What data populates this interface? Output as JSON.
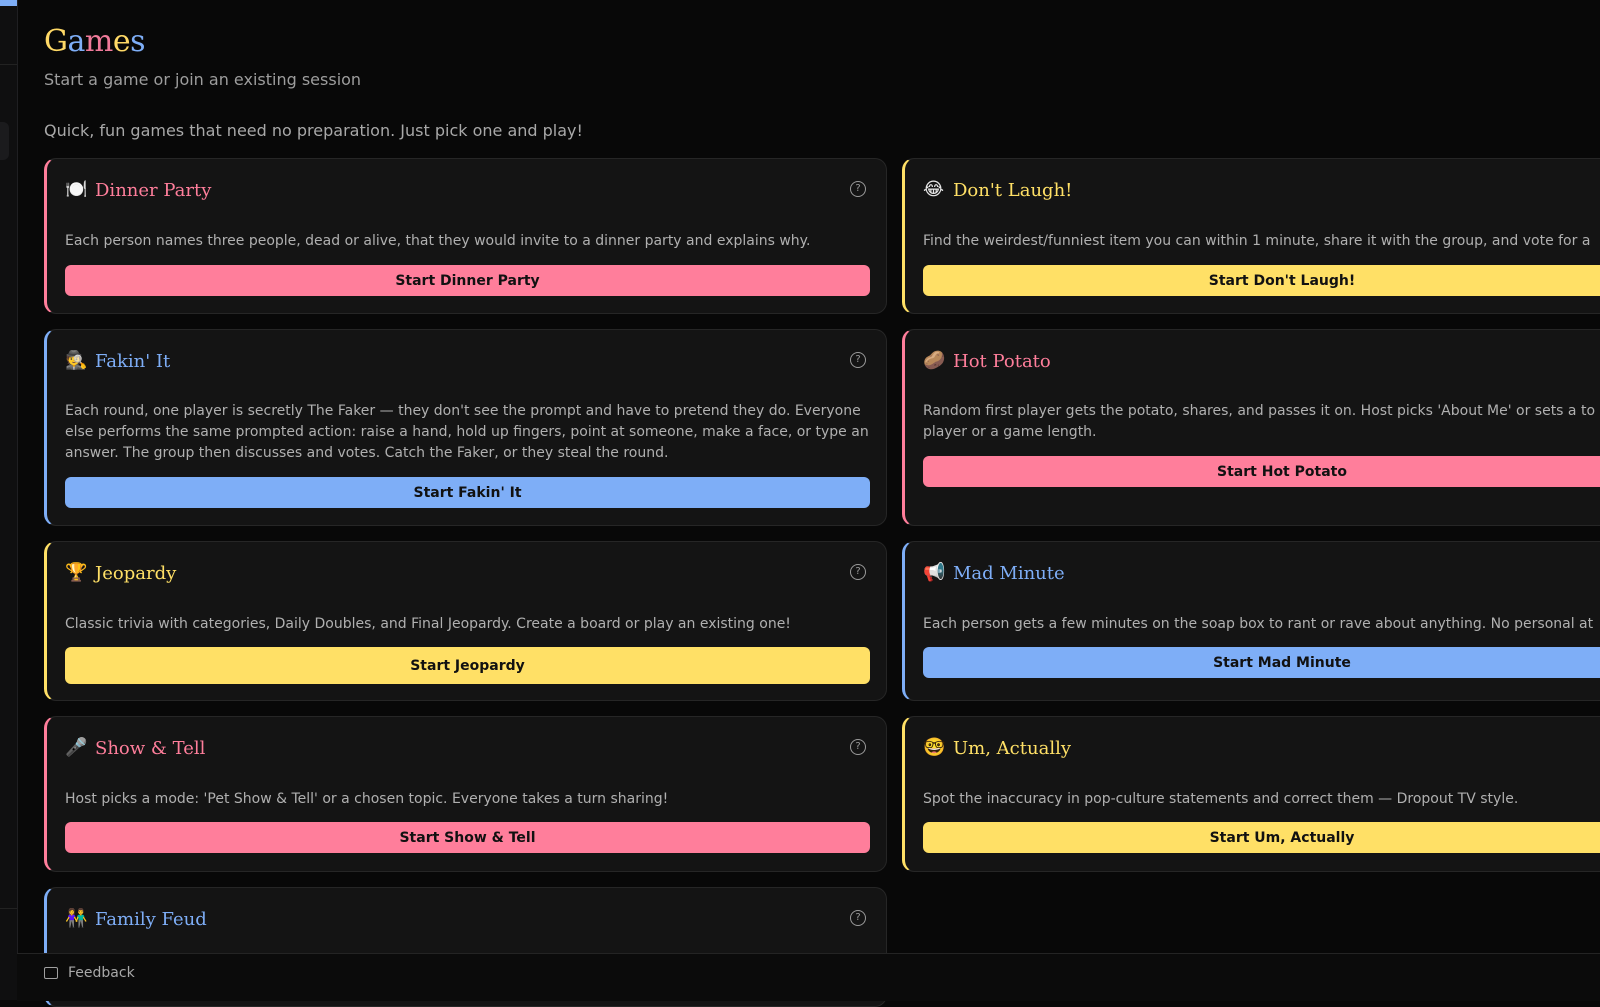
{
  "header": {
    "title_letters": [
      "G",
      "a",
      "m",
      "e",
      "s"
    ],
    "subtitle": "Start a game or join an existing session",
    "intro": "Quick, fun games that need no preparation. Just pick one and play!"
  },
  "games": [
    {
      "emoji": "🍽️",
      "title": "Dinner Party",
      "description": "Each person names three people, dead or alive, that they would invite to a dinner party and explains why.",
      "button": "Start Dinner Party",
      "accent": "pink"
    },
    {
      "emoji": "😂",
      "title": "Don't Laugh!",
      "description": "Find the weirdest/funniest item you can within 1 minute, share it with the group, and vote for a",
      "button": "Start Don't Laugh!",
      "accent": "yellow"
    },
    {
      "emoji": "🕵️",
      "title": "Fakin' It",
      "description": "Each round, one player is secretly The Faker — they don't see the prompt and have to pretend they do. Everyone else performs the same prompted action: raise a hand, hold up fingers, point at someone, make a face, or type an answer. The group then discusses and votes. Catch the Faker, or they steal the round.",
      "button": "Start Fakin' It",
      "accent": "blue"
    },
    {
      "emoji": "🥔",
      "title": "Hot Potato",
      "description": "Random first player gets the potato, shares, and passes it on. Host picks 'About Me' or sets a to per player or a game length.",
      "button": "Start Hot Potato",
      "accent": "pink"
    },
    {
      "emoji": "🏆",
      "title": "Jeopardy",
      "description": "Classic trivia with categories, Daily Doubles, and Final Jeopardy. Create a board or play an existing one!",
      "button": "Start Jeopardy",
      "accent": "yellow"
    },
    {
      "emoji": "📢",
      "title": "Mad Minute",
      "description": "Each person gets a few minutes on the soap box to rant or rave about anything. No personal at",
      "button": "Start Mad Minute",
      "accent": "blue"
    },
    {
      "emoji": "🎤",
      "title": "Show & Tell",
      "description": "Host picks a mode: 'Pet Show & Tell' or a chosen topic. Everyone takes a turn sharing!",
      "button": "Start Show & Tell",
      "accent": "pink"
    },
    {
      "emoji": "🤓",
      "title": "Um, Actually",
      "description": "Spot the inaccuracy in pop-culture statements and correct them — Dropout TV style.",
      "button": "Start Um, Actually",
      "accent": "yellow"
    },
    {
      "emoji": "👫",
      "title": "Family Feud",
      "description": "",
      "button": "",
      "accent": "blue"
    }
  ],
  "help_glyph": "?",
  "footer": {
    "feedback_label": "Feedback",
    "feedback_icon": "message-square-icon"
  },
  "colors": {
    "pink": "#ff7e9b",
    "yellow": "#ffe066",
    "blue": "#7eaef7",
    "background": "#080808",
    "card": "#141414"
  }
}
